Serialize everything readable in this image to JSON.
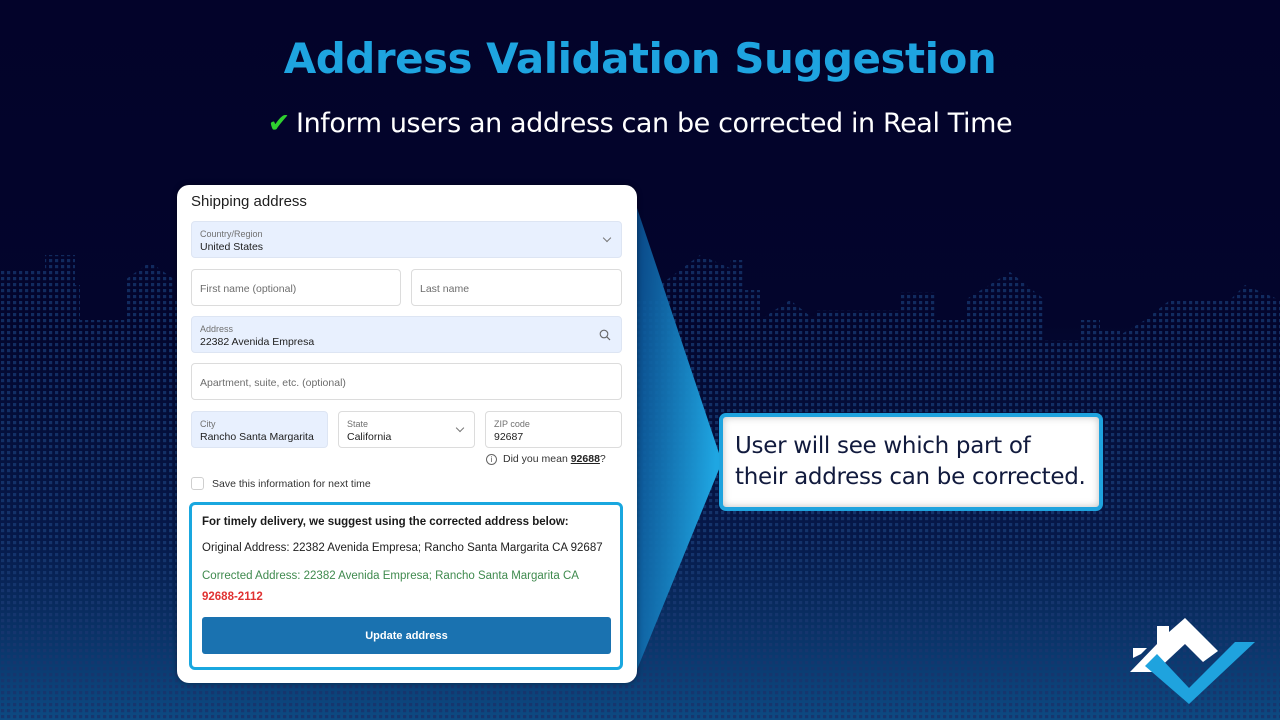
{
  "slide": {
    "title": "Address Validation Suggestion",
    "subtitle": "Inform users an address can be corrected in Real Time",
    "subtitle_icon": "check-icon",
    "colors": {
      "title": "#1ea4e0",
      "check": "#2fd12f",
      "accent": "#19a7df",
      "button": "#1a72b0",
      "corrected_text": "#3f8a4e",
      "corrected_zip": "#e03232"
    }
  },
  "form": {
    "heading": "Shipping address",
    "country": {
      "label": "Country/Region",
      "value": "United States"
    },
    "first_name": {
      "placeholder": "First name (optional)"
    },
    "last_name": {
      "placeholder": "Last name"
    },
    "address": {
      "label": "Address",
      "value": "22382 Avenida Empresa"
    },
    "apartment": {
      "placeholder": "Apartment, suite, etc. (optional)"
    },
    "city": {
      "label": "City",
      "value": "Rancho Santa Margarita"
    },
    "state": {
      "label": "State",
      "value": "California"
    },
    "zip": {
      "label": "ZIP code",
      "value": "92687"
    },
    "zip_hint": {
      "prefix": "Did you mean",
      "suggestion": "92688",
      "suffix": "?"
    },
    "save_info": {
      "label": "Save this information for next time",
      "checked": false
    },
    "suggestion": {
      "heading": "For timely delivery, we suggest using the corrected address below:",
      "original": "Original Address: 22382 Avenida Empresa; Rancho Santa Margarita CA 92687",
      "corrected": "Corrected Address: 22382 Avenida Empresa; Rancho Santa Margarita CA",
      "corrected_zip": "92688-2112",
      "button_label": "Update address"
    }
  },
  "callout": {
    "line1": "User will see which part of",
    "line2": "their address can be corrected."
  },
  "logo": {
    "icon": "house-check-logo-icon"
  }
}
